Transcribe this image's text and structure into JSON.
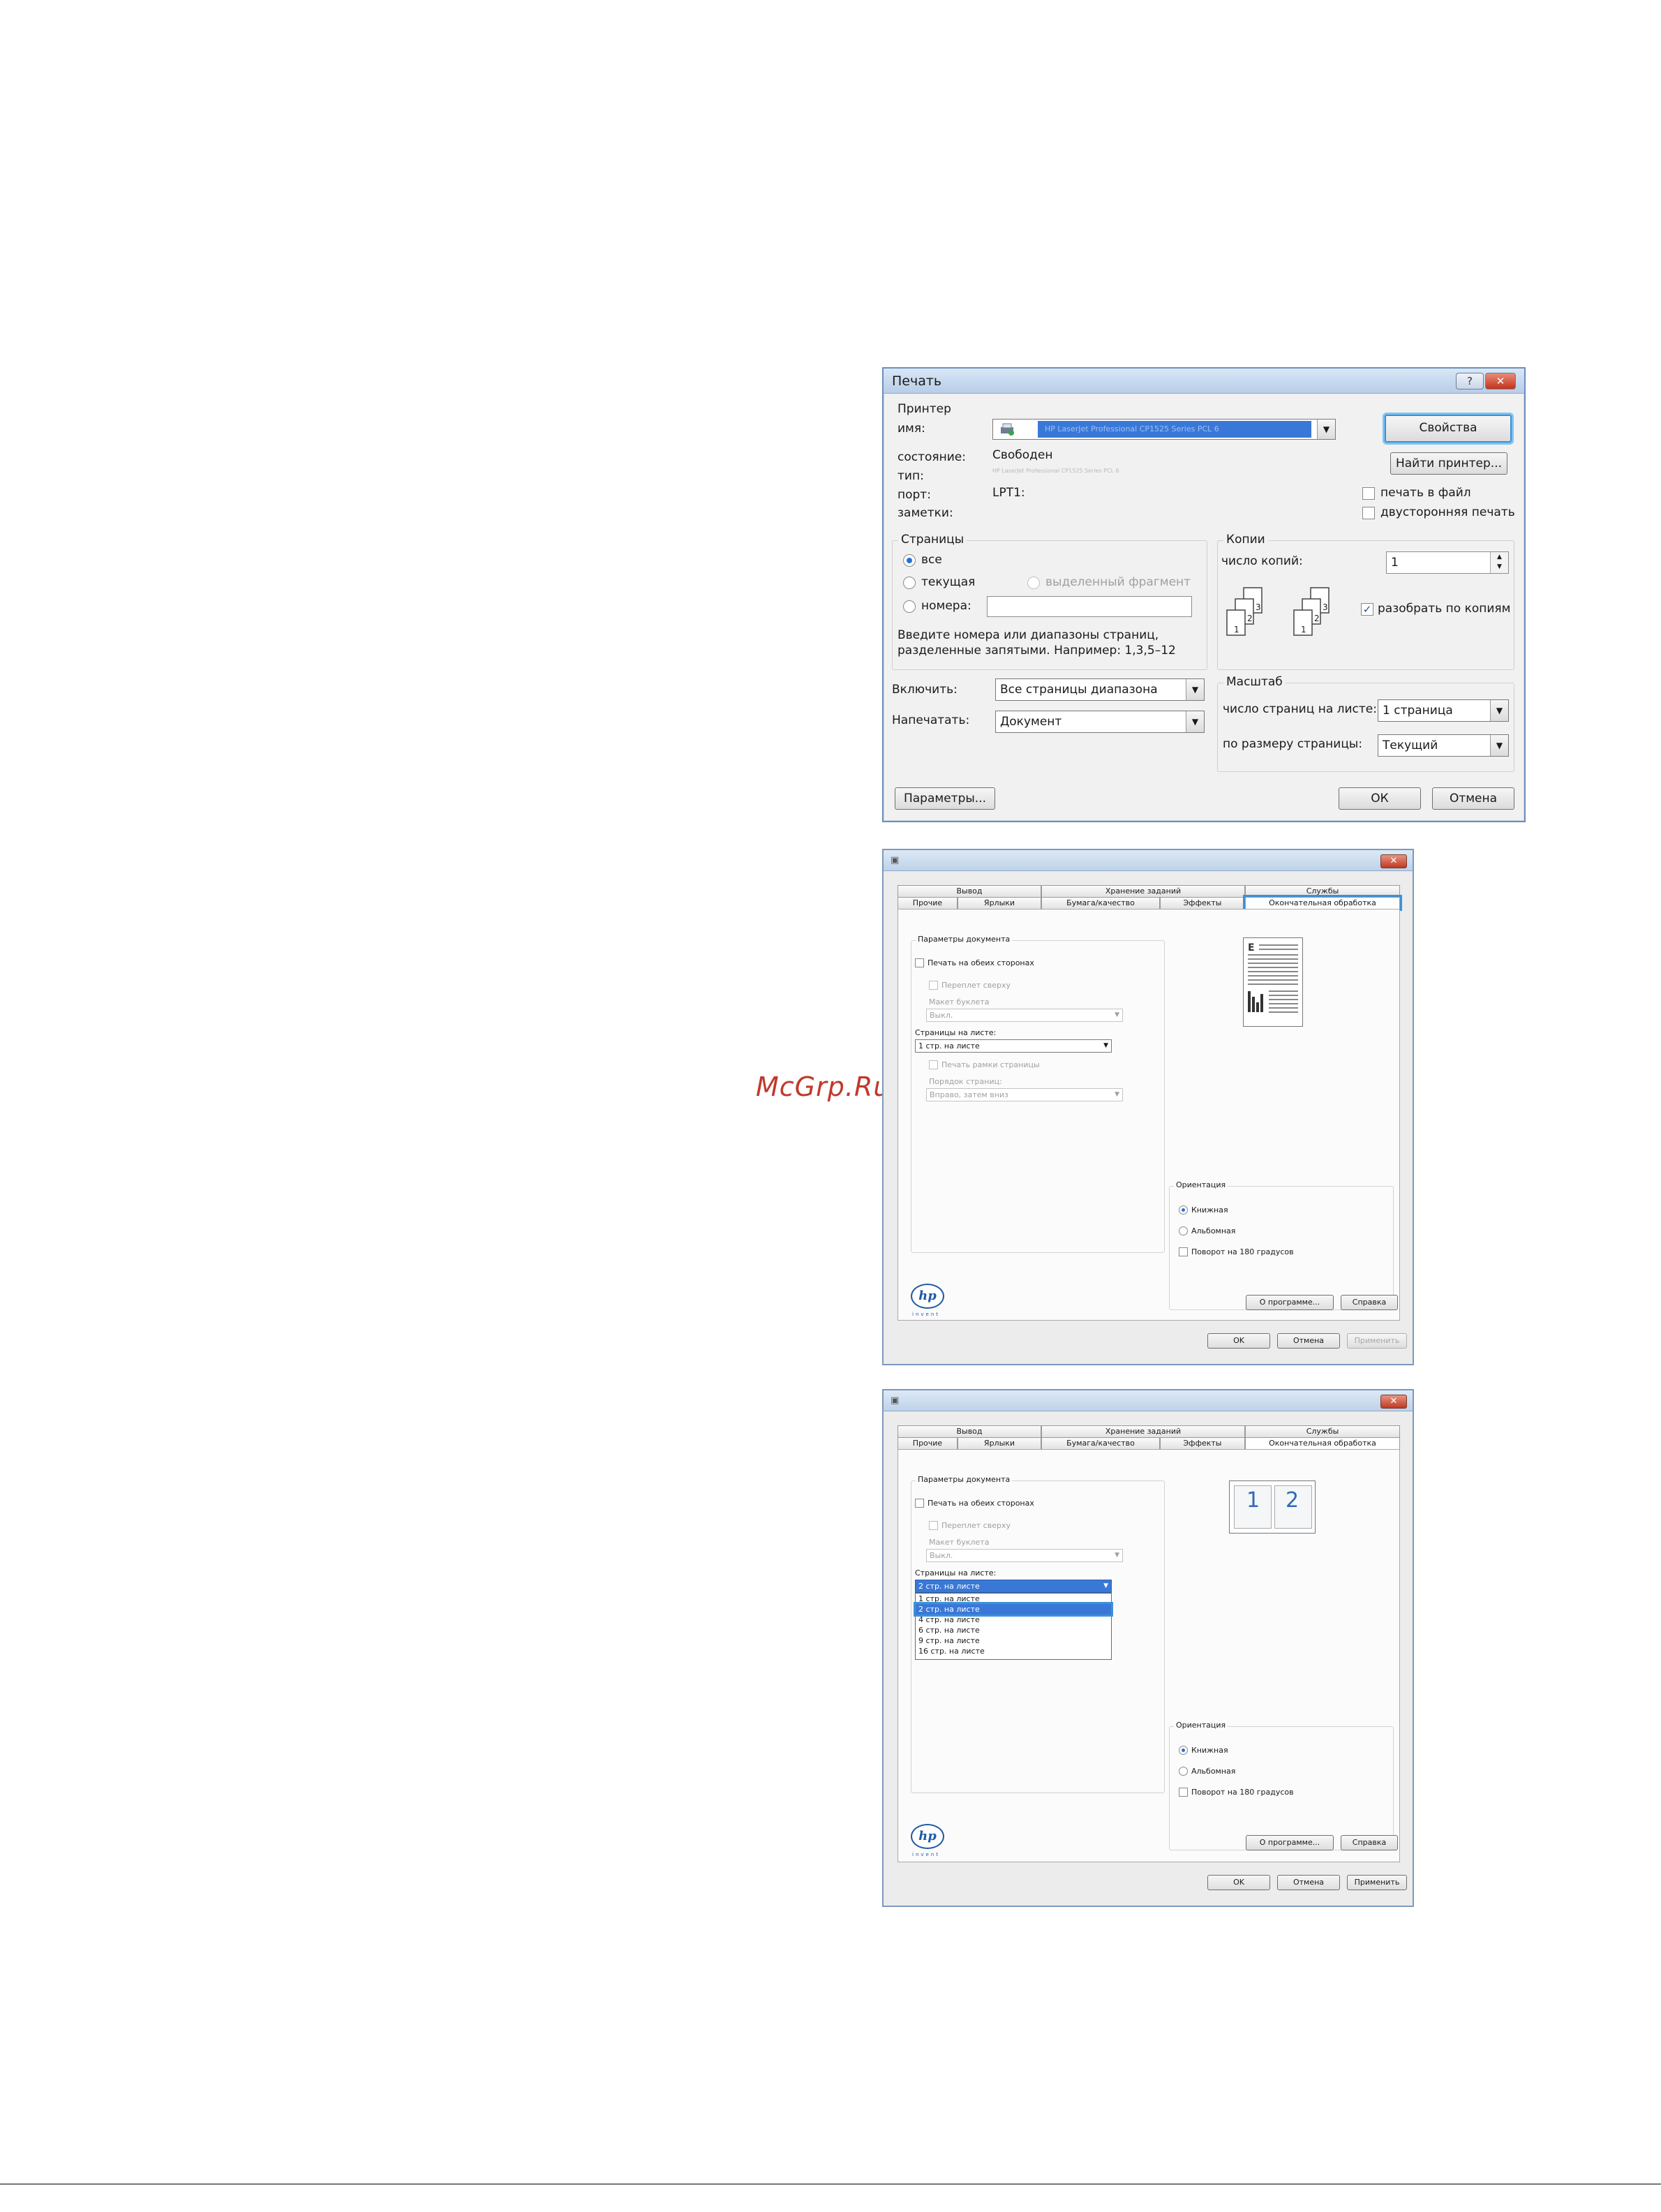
{
  "watermark": "McGrp.Ru",
  "print_dialog": {
    "title": "Печать",
    "help_glyph": "?",
    "close_glyph": "✕",
    "printer_group": "Принтер",
    "name_label": "имя:",
    "name_value": "HP LaserJet Professional CP1525 Series PCL 6",
    "status_label": "состояние:",
    "status_value": "Свободен",
    "type_label": "тип:",
    "type_value": "HP LaserJet Professional CP1525 Series PCL 6",
    "port_label": "порт:",
    "port_value": "LPT1:",
    "notes_label": "заметки:",
    "properties_button": "Свойства",
    "find_printer_button": "Найти принтер...",
    "print_to_file": "печать в файл",
    "duplex": "двусторонняя печать",
    "pages_group": "Страницы",
    "all": "все",
    "current": "текущая",
    "selection": "выделенный фрагмент",
    "pages": "номера:",
    "pages_hint_1": "Введите номера или диапазоны страниц,",
    "pages_hint_2": "разделенные запятыми. Например: 1,3,5–12",
    "copies_group": "Копии",
    "copies_label": "число копий:",
    "copies_value": "1",
    "collate": "разобрать по копиям",
    "include_label": "Включить:",
    "include_value": "Все страницы диапазона",
    "print_what_label": "Напечатать:",
    "print_what_value": "Документ",
    "zoom_group": "Масштаб",
    "pages_per_sheet_label": "число страниц на листе:",
    "pages_per_sheet_value": "1 страница",
    "scale_label": "по размеру страницы:",
    "scale_value": "Текущий",
    "options_button": "Параметры...",
    "ok_button": "ОК",
    "cancel_button": "Отмена",
    "collate_digits": [
      "3",
      "2",
      "1",
      "3",
      "2",
      "1"
    ]
  },
  "driver_tabs": {
    "row1": [
      "Вывод",
      "Хранение заданий",
      "Службы"
    ],
    "row2": [
      "Прочие",
      "Ярлыки",
      "Бумага/качество",
      "Эффекты",
      "Окончательная обработка"
    ]
  },
  "driver": {
    "close_glyph": "✕",
    "doc_options": "Параметры документа",
    "duplex": "Печать на обеих сторонах",
    "flip_up": "Переплет сверху",
    "booklet_layout": "Макет буклета",
    "off": "Выкл.",
    "pages_per_sheet": "Страницы на листе:",
    "print_borders": "Печать рамки страницы",
    "page_order": "Порядок страниц:",
    "order_value": "Вправо, затем вниз",
    "orientation": "Ориентация",
    "portrait": "Книжная",
    "landscape": "Альбомная",
    "rotate": "Поворот на 180 градусов",
    "about_button": "О программе...",
    "help_button": "Справка",
    "ok_button": "OK",
    "cancel_button": "Отмена",
    "apply_button": "Применить",
    "hp_logo": "hp",
    "invent": "invent"
  },
  "dialog2": {
    "pages_per_sheet_value": "1 стр. на листе"
  },
  "dialog3": {
    "pages_per_sheet_value": "2 стр. на листе",
    "preview_numbers": [
      "1",
      "2"
    ],
    "dropdown_options": [
      "1 стр. на листе",
      "2 стр. на листе",
      "4 стр. на листе",
      "6 стр. на листе",
      "9 стр. на листе",
      "16 стр. на листе"
    ],
    "selected_option": "2 стр. на листе"
  }
}
